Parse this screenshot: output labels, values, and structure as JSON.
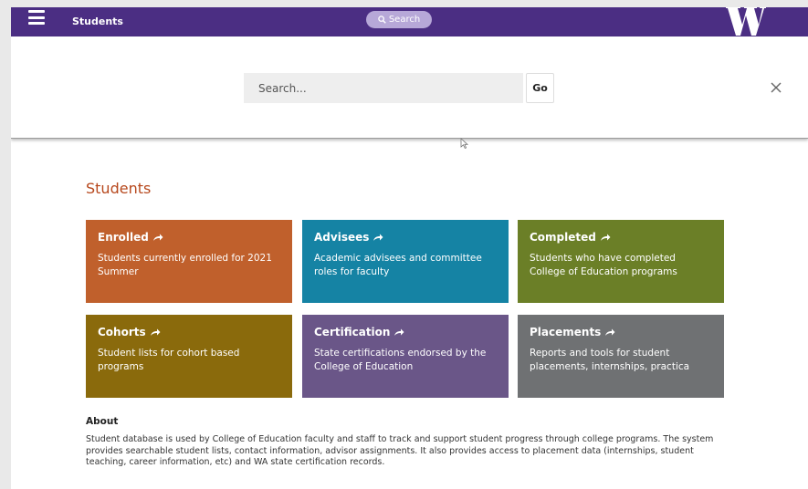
{
  "header": {
    "title": "Students",
    "search_label": "Search"
  },
  "search_panel": {
    "placeholder": "Search...",
    "go_label": "Go"
  },
  "main": {
    "section_title": "Students",
    "tiles": [
      {
        "title": "Enrolled",
        "description": "Students currently enrolled for 2021 Summer",
        "color": "#c0602c"
      },
      {
        "title": "Advisees",
        "description": "Academic advisees and committee roles for faculty",
        "color": "#1583a4"
      },
      {
        "title": "Completed",
        "description": "Students who have completed College of Education programs",
        "color": "#6b7f27"
      },
      {
        "title": "Cohorts",
        "description": "Student lists for cohort based programs",
        "color": "#8a6a0c"
      },
      {
        "title": "Certification",
        "description": "State certifications endorsed by the College of Education",
        "color": "#6a5688"
      },
      {
        "title": "Placements",
        "description": "Reports and tools for student placements, internships, practica",
        "color": "#6f7173"
      }
    ],
    "about_title": "About",
    "about_text": "Student database is used by College of Education faculty and staff to track and support student progress through college programs. The system provides searchable student lists, contact information, advisor assignments. It also provides access to placement data (internships, student teaching, career information, etc) and WA state certification records."
  },
  "colors": {
    "brand_purple": "#4b2e83",
    "section_title": "#b7481d"
  },
  "icons": [
    "menu-icon",
    "search-icon",
    "uw-logo",
    "close-icon",
    "arrow-right-icon",
    "mouse-cursor"
  ]
}
